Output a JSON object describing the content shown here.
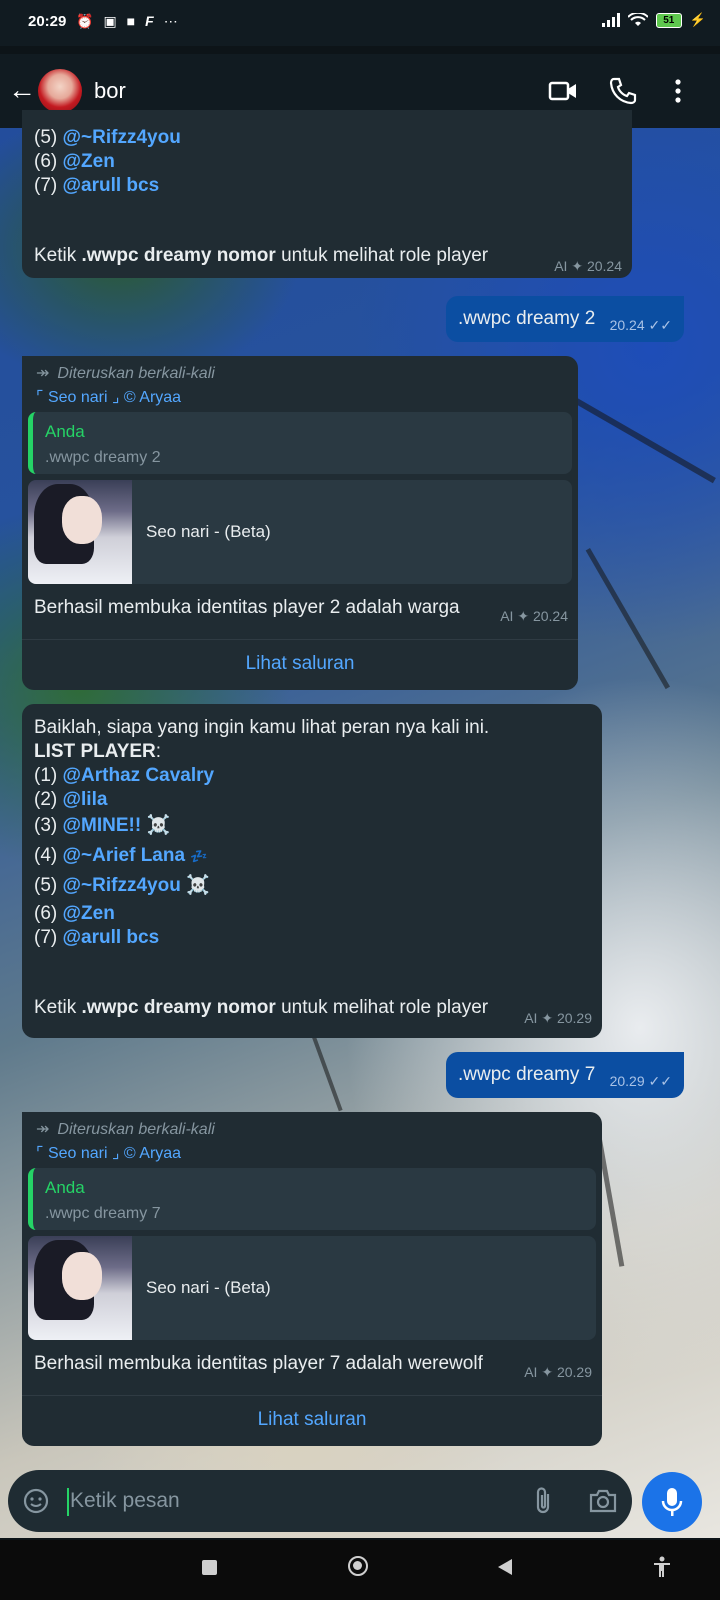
{
  "status_bar": {
    "time": "20:29",
    "battery": "51",
    "icons_left": [
      "alarm-icon",
      "message-icon",
      "square-icon",
      "f-icon",
      "more-icon"
    ],
    "icons_right": [
      "signal-icon",
      "wifi-icon",
      "battery-icon",
      "charging-icon"
    ]
  },
  "header": {
    "title": "bor",
    "icons": [
      "back-arrow-icon",
      "video-call-icon",
      "voice-call-icon",
      "menu-dots-icon"
    ]
  },
  "messages": [
    {
      "type": "incoming",
      "lines": [
        "(5) ",
        "@~Rifzz4you",
        "(6) ",
        "@Zen",
        "(7) ",
        "@arull bcs"
      ],
      "footer_prefix": "Ketik ",
      "footer_bold": ".wwpc dreamy nomor",
      "footer_suffix": " untuk melihat role player",
      "meta": "AI",
      "time": "20.24"
    },
    {
      "type": "outgoing",
      "text": ".wwpc dreamy 2",
      "time": "20.24"
    },
    {
      "type": "forwarded",
      "forwarded_label": "Diteruskan berkali-kali",
      "channel": "⌜ Seo nari ⌟ © Aryaa",
      "quote_name": "Anda",
      "quote_text": ".wwpc dreamy 2",
      "preview_title": "Seo nari - (Beta)",
      "text": "Berhasil membuka identitas player 2 adalah warga",
      "meta": "AI",
      "time": "20.24",
      "button": "Lihat saluran"
    },
    {
      "type": "incoming",
      "intro": "Baiklah, siapa yang ingin kamu lihat peran nya kali ini.",
      "heading": "LIST PLAYER",
      "players": [
        {
          "num": "(1) ",
          "name": "@Arthaz Cavalry",
          "emoji": ""
        },
        {
          "num": "(2) ",
          "name": "@lila",
          "emoji": ""
        },
        {
          "num": "(3) ",
          "name": "@MINE!!",
          "emoji": "☠️"
        },
        {
          "num": "(4) ",
          "name": "@~Arief Lana",
          "emoji": "💤"
        },
        {
          "num": "(5) ",
          "name": "@~Rifzz4you",
          "emoji": "☠️"
        },
        {
          "num": "(6) ",
          "name": "@Zen",
          "emoji": ""
        },
        {
          "num": "(7) ",
          "name": "@arull bcs",
          "emoji": ""
        }
      ],
      "footer_prefix": "Ketik ",
      "footer_bold": ".wwpc dreamy nomor",
      "footer_suffix": " untuk melihat role player",
      "meta": "AI",
      "time": "20.29"
    },
    {
      "type": "outgoing",
      "text": ".wwpc dreamy 7",
      "time": "20.29"
    },
    {
      "type": "forwarded",
      "forwarded_label": "Diteruskan berkali-kali",
      "channel": "⌜ Seo nari ⌟ © Aryaa",
      "quote_name": "Anda",
      "quote_text": ".wwpc dreamy 7",
      "preview_title": "Seo nari - (Beta)",
      "text": "Berhasil membuka identitas player 7 adalah werewolf",
      "meta": "AI",
      "time": "20.29",
      "button": "Lihat saluran"
    }
  ],
  "input": {
    "placeholder": "Ketik pesan",
    "icons": [
      "sticker-icon",
      "attach-icon",
      "camera-icon",
      "mic-icon"
    ]
  },
  "nav": {
    "icons": [
      "recents-icon",
      "home-icon",
      "back-icon",
      "accessibility-icon"
    ]
  },
  "colors": {
    "bubble_in": "#202c33",
    "bubble_out": "#0b4ea2",
    "mention": "#53a7ff",
    "quote_accent": "#25d366"
  }
}
